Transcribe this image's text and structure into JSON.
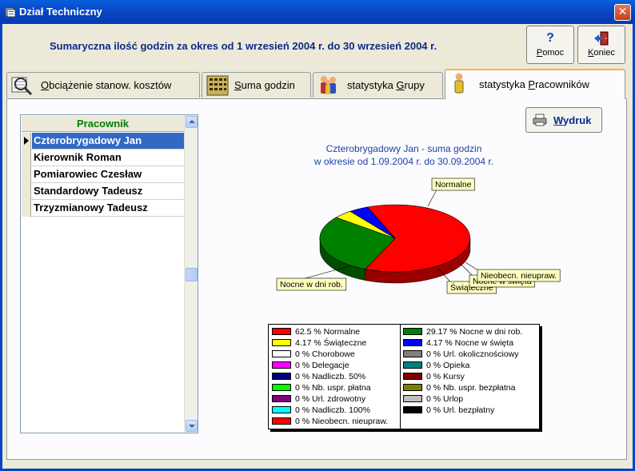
{
  "window": {
    "title": "Dział Techniczny",
    "close_label": "✕"
  },
  "summary": "Sumaryczna ilość godzin za okres od 1 wrzesień 2004 r. do 30 wrzesień 2004 r.",
  "toolbar": {
    "help": {
      "glyph": "?",
      "label_first": "P",
      "label_rest": "omoc"
    },
    "exit": {
      "label_first": "K",
      "label_rest": "oniec"
    }
  },
  "tabs": [
    {
      "first": "O",
      "rest": "bciążenie stanow. kosztów"
    },
    {
      "first": "S",
      "rest": "uma godzin"
    },
    {
      "pre": "statystyka ",
      "first": "G",
      "rest": "rupy"
    },
    {
      "pre": "statystyka ",
      "first": "P",
      "rest": "racowników"
    }
  ],
  "list": {
    "header": "Pracownik",
    "rows": [
      "Czterobrygadowy Jan",
      "Kierownik Roman",
      "Pomiarowiec Czesław",
      "Standardowy Tadeusz",
      "Trzyzmianowy Tadeusz"
    ]
  },
  "print": {
    "first": "W",
    "rest": "ydruk"
  },
  "chart_data": {
    "type": "pie",
    "title_lines": [
      "Czterobrygadowy Jan - suma godzin",
      "w okresie od 1.09.2004 r. do 30.09.2004 r."
    ],
    "slices": [
      {
        "label": "Normalne",
        "value": 62.5,
        "color": "#ff0000"
      },
      {
        "label": "Nocne w dni rob.",
        "value": 29.17,
        "color": "#008000"
      },
      {
        "label": "Świąteczne",
        "value": 4.17,
        "color": "#ffff00"
      },
      {
        "label": "Nocne w święta",
        "value": 4.17,
        "color": "#0000ff"
      },
      {
        "label": "Nieobecn. nieupraw.",
        "value": 0,
        "color": "#ff0000"
      }
    ],
    "callouts": [
      "Normalne",
      "Nocne w dni rob.",
      "Świąteczne",
      "Nocne w święta",
      "Nieobecn. nieupraw."
    ],
    "legend": {
      "left": [
        {
          "text": "62.5 % Normalne",
          "color": "#ff0000"
        },
        {
          "text": "4.17 % Świąteczne",
          "color": "#ffff00"
        },
        {
          "text": "0 % Chorobowe",
          "color": "#ffffff"
        },
        {
          "text": "0 % Delegacje",
          "color": "#ff00ff"
        },
        {
          "text": "0 % Nadliczb. 50%",
          "color": "#000080"
        },
        {
          "text": "0 % Nb. uspr. płatna",
          "color": "#00ff00"
        },
        {
          "text": "0 % Url. zdrowotny",
          "color": "#800080"
        },
        {
          "text": "0 % Nadliczb. 100%",
          "color": "#00ffff"
        },
        {
          "text": "0 % Nieobecn. nieupraw.",
          "color": "#ff0000"
        }
      ],
      "right": [
        {
          "text": "29.17 % Nocne w dni rob.",
          "color": "#008000"
        },
        {
          "text": "4.17 % Nocne w święta",
          "color": "#0000ff"
        },
        {
          "text": "0 % Url. okolicznościowy",
          "color": "#808080"
        },
        {
          "text": "0 % Opieka",
          "color": "#008080"
        },
        {
          "text": "0 % Kursy",
          "color": "#800000"
        },
        {
          "text": "0 % Nb. uspr. bezpłatna",
          "color": "#808000"
        },
        {
          "text": "0 % Urlop",
          "color": "#c0c0c0"
        },
        {
          "text": "0 % Url. bezpłatny",
          "color": "#000000"
        }
      ]
    }
  }
}
